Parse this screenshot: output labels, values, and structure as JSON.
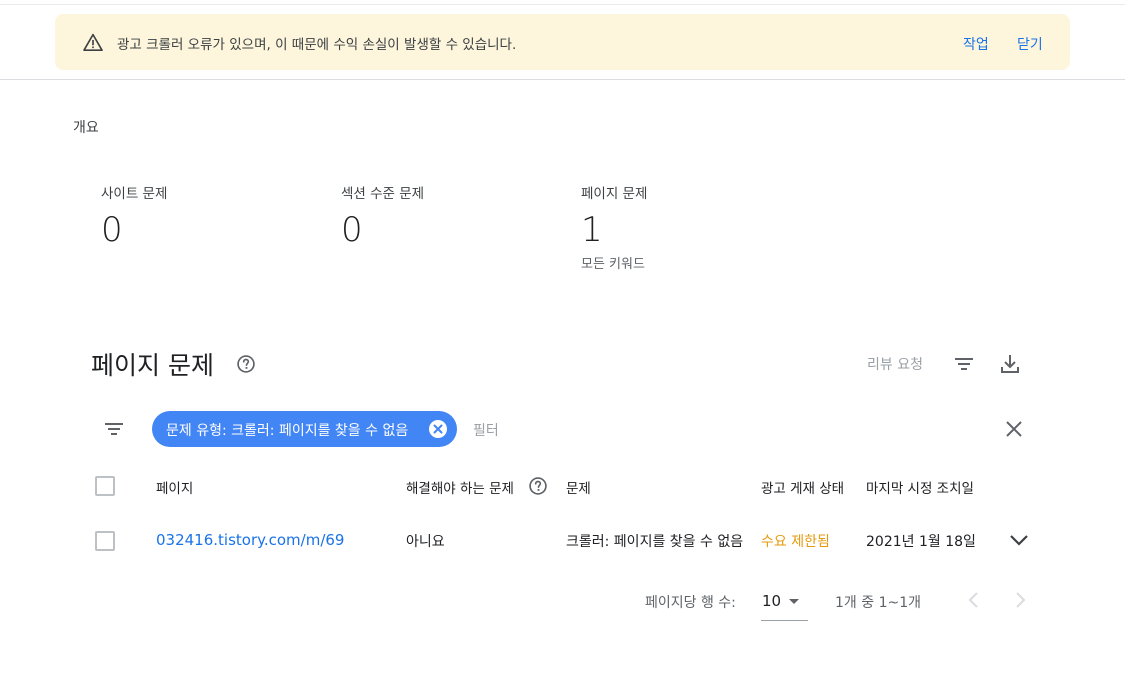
{
  "alert": {
    "message": "광고 크롤러 오류가 있으며, 이 때문에 수익 손실이 발생할 수 있습니다.",
    "action_label": "작업",
    "close_label": "닫기",
    "icon": "warning-icon"
  },
  "overview": {
    "title": "개요",
    "stats": [
      {
        "label": "사이트 문제",
        "value": "0",
        "sub": ""
      },
      {
        "label": "섹션 수준 문제",
        "value": "0",
        "sub": ""
      },
      {
        "label": "페이지 문제",
        "value": "1",
        "sub": "모든 키워드"
      }
    ]
  },
  "issues": {
    "title": "페이지 문제",
    "review_label": "리뷰 요청",
    "filter_chip": "문제 유형: 크롤러: 페이지를 찾을 수 없음",
    "filter_placeholder": "필터",
    "columns": [
      "페이지",
      "해결해야 하는 문제",
      "문제",
      "광고 게재 상태",
      "마지막 시정 조치일"
    ],
    "rows": [
      {
        "page": "032416.tistory.com/m/69",
        "must_fix": "아니요",
        "issue": "크롤러: 페이지를 찾을 수 없음",
        "ad_status": "수요 제한됨",
        "last_action": "2021년 1월 18일"
      }
    ],
    "status_color": "#e69a0d",
    "link_color": "#1a73e8"
  },
  "pagination": {
    "rows_label": "페이지당 행 수:",
    "rows_value": "10",
    "range": "1개 중 1~1개"
  }
}
